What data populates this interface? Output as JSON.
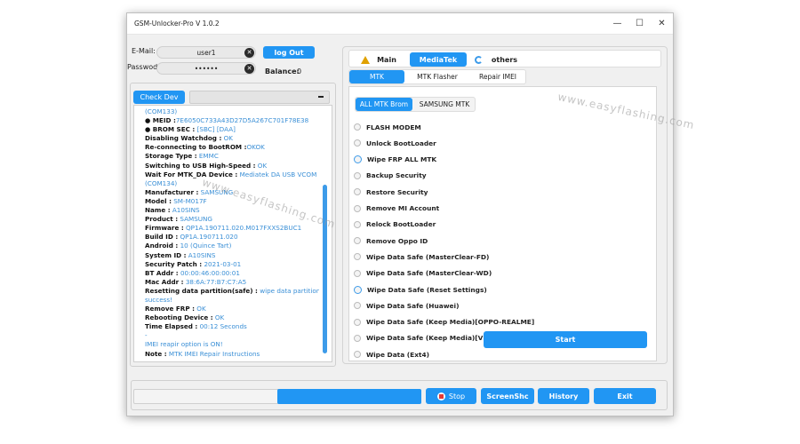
{
  "window": {
    "title": "GSM-Unlocker-Pro V 1.0.2",
    "minimize": "—",
    "maximize": "☐",
    "close": "✕"
  },
  "login": {
    "email_label": "E-Mail:",
    "email_value": "user1",
    "password_label": "Passwod:",
    "password_value": "••••••",
    "logout_label": "log Out",
    "balance_label": "Balance:",
    "balance_value": "0"
  },
  "device": {
    "check_label": "Check Dev",
    "combo_value": ""
  },
  "log": {
    "lines": [
      [
        {
          "t": "(COM133)",
          "c": "v"
        }
      ],
      [
        {
          "t": "● MEID :",
          "c": "k"
        },
        {
          "t": "7E6050C733A43D27D5A267C701F78E38",
          "c": "v"
        }
      ],
      [
        {
          "t": "● BROM SEC   :",
          "c": "k"
        },
        {
          "t": " [SBC] [DAA]",
          "c": "v"
        }
      ],
      [
        {
          "t": "Disabling Watchdog :",
          "c": "k"
        },
        {
          "t": " OK",
          "c": "v"
        }
      ],
      [
        {
          "t": "Re-connecting to BootROM :",
          "c": "k"
        },
        {
          "t": "OKOK",
          "c": "v"
        }
      ],
      [
        {
          "t": "Storage Type :",
          "c": "k"
        },
        {
          "t": " EMMC",
          "c": "v"
        }
      ],
      [
        {
          "t": "Switching to USB High-Speed :",
          "c": "k"
        },
        {
          "t": " OK",
          "c": "v"
        }
      ],
      [
        {
          "t": "Wait For MTK_DA Device :",
          "c": "k"
        },
        {
          "t": " Mediatek DA USB VCOM",
          "c": "v"
        }
      ],
      [
        {
          "t": "(COM134)",
          "c": "v"
        }
      ],
      [
        {
          "t": "Manufacturer :",
          "c": "k"
        },
        {
          "t": " SAMSUNG",
          "c": "v"
        }
      ],
      [
        {
          "t": "Model :",
          "c": "k"
        },
        {
          "t": " SM-M017F",
          "c": "v"
        }
      ],
      [
        {
          "t": "Name :",
          "c": "k"
        },
        {
          "t": " A10SINS",
          "c": "v"
        }
      ],
      [
        {
          "t": "Product :",
          "c": "k"
        },
        {
          "t": " SAMSUNG",
          "c": "v"
        }
      ],
      [
        {
          "t": "Firmware :",
          "c": "k"
        },
        {
          "t": " QP1A.190711.020.M017FXXS2BUC1",
          "c": "v"
        }
      ],
      [
        {
          "t": "Build ID :",
          "c": "k"
        },
        {
          "t": " QP1A.190711.020",
          "c": "v"
        }
      ],
      [
        {
          "t": "Android :",
          "c": "k"
        },
        {
          "t": " 10 (Quince Tart)",
          "c": "v"
        }
      ],
      [
        {
          "t": "System ID :",
          "c": "k"
        },
        {
          "t": " A10SINS",
          "c": "v"
        }
      ],
      [
        {
          "t": "Security Patch :",
          "c": "k"
        },
        {
          "t": " 2021-03-01",
          "c": "v"
        }
      ],
      [
        {
          "t": "BT Addr :",
          "c": "k"
        },
        {
          "t": " 00:00:46:00:00:01",
          "c": "v"
        }
      ],
      [
        {
          "t": "Mac Addr :",
          "c": "k"
        },
        {
          "t": " 38:6A:77:B7:C7:A5",
          "c": "v"
        }
      ],
      [
        {
          "t": " Resetting data partition(safe) :",
          "c": "k"
        },
        {
          "t": " wipe data partition",
          "c": "v"
        }
      ],
      [
        {
          "t": "success!",
          "c": "v"
        }
      ],
      [
        {
          "t": "Remove FRP :",
          "c": "k"
        },
        {
          "t": " OK",
          "c": "v"
        }
      ],
      [
        {
          "t": "Rebooting Device :",
          "c": "k"
        },
        {
          "t": " OK",
          "c": "v"
        }
      ],
      [
        {
          "t": "Time Elapsed :",
          "c": "k"
        },
        {
          "t": " 00:12 Seconds",
          "c": "v"
        }
      ],
      [
        {
          "t": "-",
          "c": "v"
        }
      ],
      [
        {
          "t": "IMEI reapir option is ON!",
          "c": "v"
        }
      ],
      [
        {
          "t": "Note :",
          "c": "k"
        },
        {
          "t": " MTK IMEI Repair Instructions",
          "c": "v"
        }
      ]
    ]
  },
  "tabs": {
    "main": "Main",
    "mediatek": "MediaTek",
    "others": "others"
  },
  "subtabs": {
    "mtk": "MTK",
    "flasher": "MTK Flasher",
    "repair": "Repair IMEI"
  },
  "inner_tabs": {
    "all_brom": "ALL MTK Brom",
    "samsung": "SAMSUNG MTK"
  },
  "options": [
    "FLASH MODEM",
    "Unlock BootLoader",
    "Wipe FRP ALL MTK",
    "Backup Security",
    "Restore Security",
    "Remove MI Account",
    "Relock BootLoader",
    "Remove Oppo ID",
    "Wipe Data Safe (MasterClear-FD)",
    "Wipe Data Safe (MasterClear-WD)",
    "Wipe Data Safe (Reset Settings)",
    "Wipe Data Safe (Huawei)",
    "Wipe Data Safe (Keep Media)[OPPO-REALME]",
    "Wipe Data Safe (Keep Media)[VIVO]",
    "Wipe Data (Ext4)"
  ],
  "start_label": "Start",
  "bottom": {
    "stop": "Stop",
    "screenshot": "ScreenShc",
    "history": "History",
    "exit": "Exit",
    "progress": 0.5
  },
  "watermark": "www.easyflashing.com",
  "colors": {
    "accent": "#2196f3",
    "value_text": "#3a8fd6",
    "stop_icon": "#e53935"
  }
}
